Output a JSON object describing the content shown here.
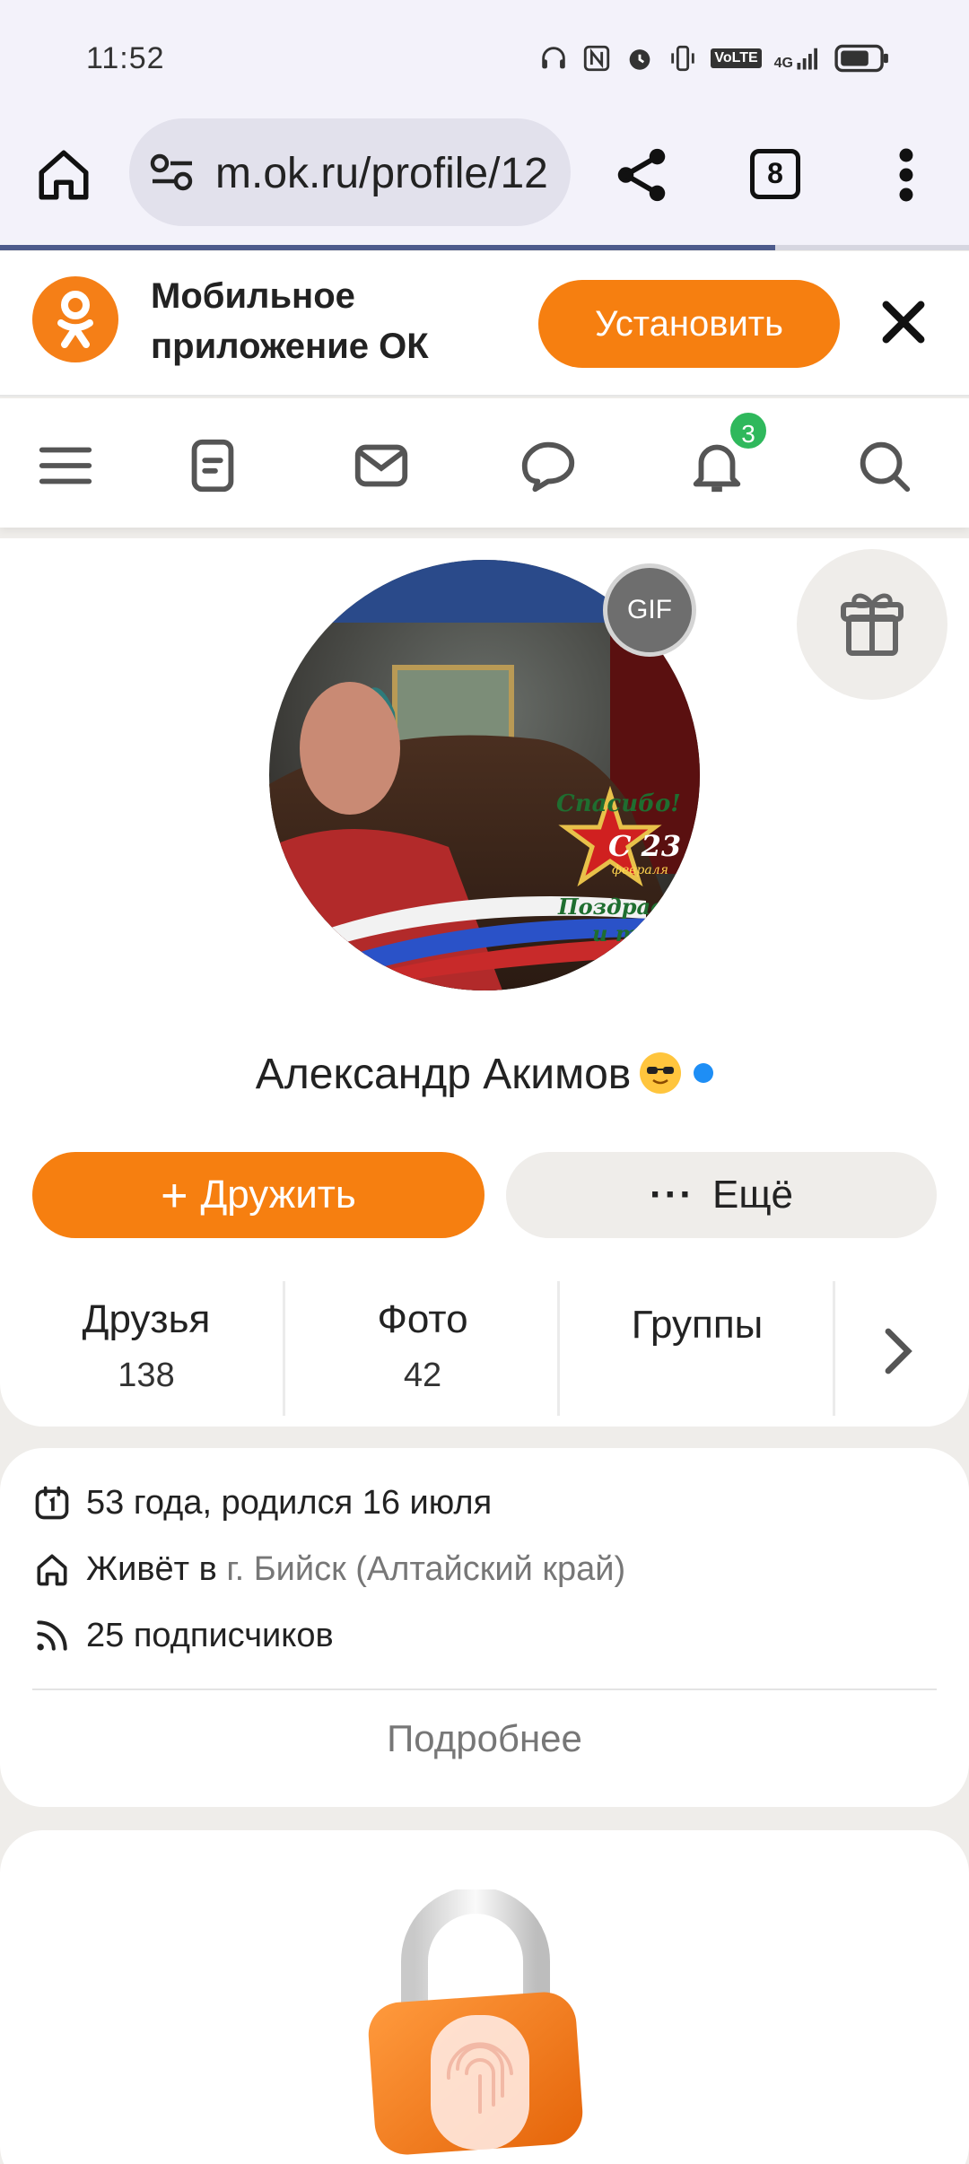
{
  "status_bar": {
    "time": "11:52",
    "volte": "VoLTE",
    "network": "4G"
  },
  "browser": {
    "url": "m.ok.ru/profile/12",
    "tab_count": "8",
    "page_load_progress": 0.8
  },
  "app_banner": {
    "title": "Мобильное приложение ОК",
    "install_label": "Установить"
  },
  "nav": {
    "notifications_count": "3",
    "icons": [
      "menu-icon",
      "feed-icon",
      "mail-icon",
      "chat-icon",
      "bell-icon",
      "search-icon"
    ]
  },
  "profile": {
    "gif_badge": "GIF",
    "avatar_text": {
      "thanks": "Спасибо!",
      "day": "С 23",
      "month": "февраля",
      "congrats1": "Поздравляю",
      "congrats2": "и тебя!"
    },
    "name": "Александр Акимов",
    "add_friend_label": "Дружить",
    "more_label": "Ещё",
    "stats": [
      {
        "label": "Друзья",
        "value": "138"
      },
      {
        "label": "Фото",
        "value": "42"
      },
      {
        "label": "Группы",
        "value": ""
      }
    ]
  },
  "info": {
    "age": "53 года, родился 16 июля",
    "lives_prefix": "Живёт в",
    "lives_city": "г. Бийск (Алтайский край)",
    "subscribers": "25 подписчиков",
    "more": "Подробнее"
  },
  "colors": {
    "accent": "#f67f10",
    "online": "#1e8ef5",
    "badge": "#2fb85c"
  }
}
